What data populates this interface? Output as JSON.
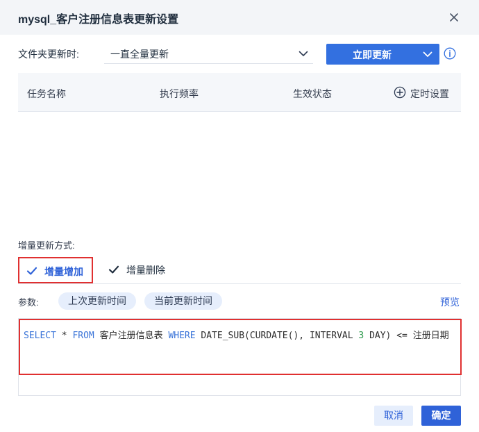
{
  "dialog": {
    "title": "mysql_客户注册信息表更新设置"
  },
  "folder_update": {
    "label": "文件夹更新时:",
    "selected": "一直全量更新"
  },
  "update_button": {
    "label": "立即更新"
  },
  "table": {
    "columns": [
      "任务名称",
      "执行频率",
      "生效状态"
    ],
    "timer_label": "定时设置",
    "rows": []
  },
  "incremental": {
    "label": "增量更新方式:",
    "tabs": [
      {
        "label": "增量增加",
        "active": true
      },
      {
        "label": "增量删除",
        "active": false
      }
    ]
  },
  "params": {
    "label": "参数:",
    "chips": [
      "上次更新时间",
      "当前更新时间"
    ],
    "preview": "预览"
  },
  "sql": {
    "text": "SELECT * FROM 客户注册信息表 WHERE DATE_SUB(CURDATE(), INTERVAL 3 DAY) <= 注册日期"
  },
  "footer": {
    "cancel": "取消",
    "confirm": "确定"
  },
  "colors": {
    "primary": "#3370e0",
    "highlight_border": "#e03030",
    "keyword": "#3a74d8",
    "number": "#2e9a4d",
    "chip_bg": "#e6eefc"
  },
  "icons": [
    "close-icon",
    "chevron-down-icon",
    "info-icon",
    "plus-circle-icon",
    "check-icon"
  ]
}
